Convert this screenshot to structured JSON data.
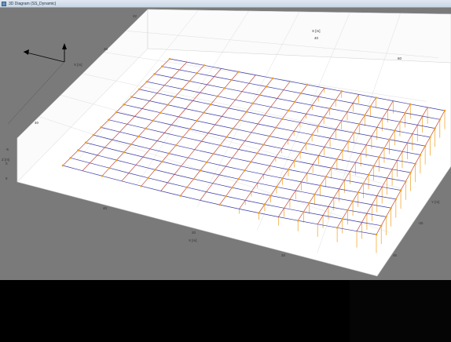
{
  "window": {
    "title": "3D Diagram (SS_Dynamic)"
  },
  "axes": {
    "x_label": "X [m]",
    "y_label": "Y [m]",
    "z_label": "Z [m]",
    "x_label_top": "X [m]",
    "triad_x_label": "X [m]",
    "x_ticks": [
      "40",
      "20",
      "20"
    ],
    "x_ticks_top": [
      "40",
      "60"
    ],
    "y_ticks": [
      "-25",
      "45"
    ],
    "z_ticks": [
      "-5",
      "0",
      "5"
    ],
    "back_ticks": [
      "22",
      "20",
      "40"
    ]
  },
  "colors": {
    "background": "#7a7a7a",
    "box_face": "#ffffff",
    "grid_lines": "#d6d6d6",
    "mesh_x": "#3a3aa8",
    "mesh_y": "#c04a3a",
    "node": "#f0a020",
    "support": "#f0a020"
  },
  "icons": {
    "triad": "axis-triad-icon",
    "app": "app-window-icon"
  }
}
